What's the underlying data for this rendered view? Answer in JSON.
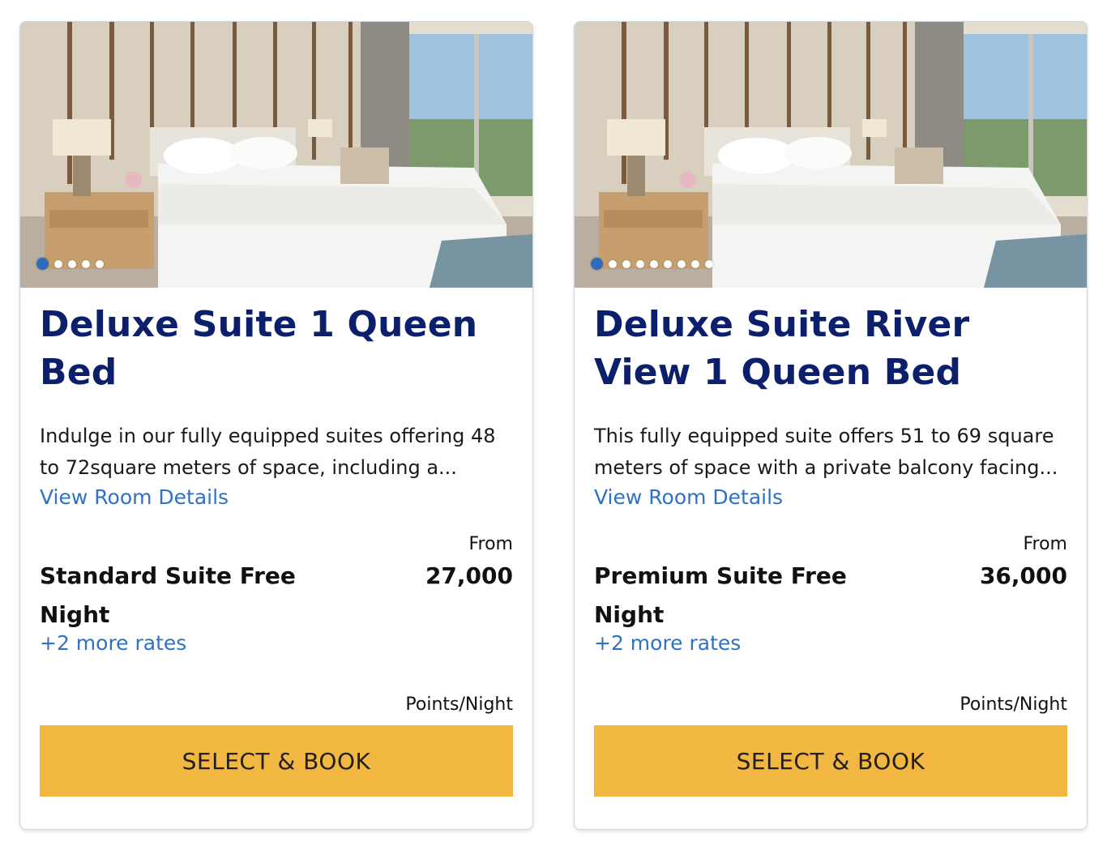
{
  "rooms": [
    {
      "title": "Deluxe Suite 1 Queen Bed",
      "description": "Indulge in our fully equipped suites offering 48 to 72square meters of space, including a...",
      "details_link": "View Room Details",
      "from_label": "From",
      "rate_name": "Standard Suite Free Night",
      "points": "27,000",
      "more_rates": "+2 more rates",
      "points_unit": "Points/Night",
      "book_label": "SELECT & BOOK",
      "carousel_count": 5,
      "carousel_active": 1
    },
    {
      "title": "Deluxe Suite River View 1 Queen Bed",
      "description": "This fully equipped suite offers 51 to 69 square meters of space with a private balcony facing...",
      "details_link": "View Room Details",
      "from_label": "From",
      "rate_name": "Premium Suite Free Night",
      "points": "36,000",
      "more_rates": "+2 more rates",
      "points_unit": "Points/Night",
      "book_label": "SELECT & BOOK",
      "carousel_count": 9,
      "carousel_active": 1
    }
  ],
  "colors": {
    "title": "#0c1f6b",
    "link": "#2f72c4",
    "button": "#f2b740",
    "dot_active": "#2f6cc0"
  }
}
